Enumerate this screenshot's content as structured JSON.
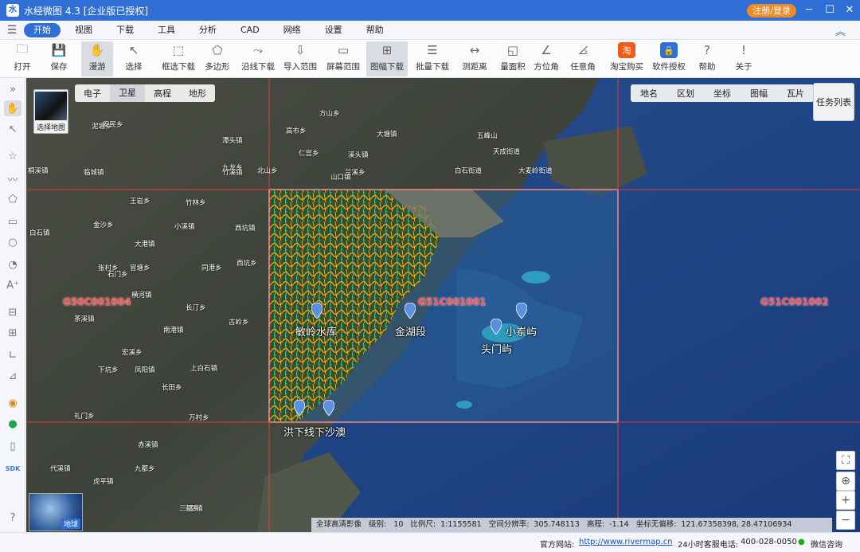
{
  "titlebar": {
    "title": "水经微图 4.3 [企业版已授权]",
    "register_label": "注册/登录"
  },
  "menu": [
    "开始",
    "视图",
    "下载",
    "工具",
    "分析",
    "CAD",
    "网络",
    "设置",
    "帮助"
  ],
  "toolbar": [
    {
      "label": "打开",
      "icon": "folder-icon"
    },
    {
      "label": "保存",
      "icon": "save-icon"
    },
    {
      "label": "漫游",
      "icon": "hand-icon"
    },
    {
      "label": "选择",
      "icon": "cursor-icon"
    },
    {
      "label": "框选下载",
      "icon": "box-download-icon"
    },
    {
      "label": "多边形",
      "icon": "polygon-icon"
    },
    {
      "label": "沿线下载",
      "icon": "line-download-icon"
    },
    {
      "label": "导入范围",
      "icon": "import-icon"
    },
    {
      "label": "屏幕范围",
      "icon": "screen-icon"
    },
    {
      "label": "图幅下载",
      "icon": "sheet-icon"
    },
    {
      "label": "批量下载",
      "icon": "batch-icon"
    },
    {
      "label": "测距离",
      "icon": "ruler-icon"
    },
    {
      "label": "量面积",
      "icon": "area-icon"
    },
    {
      "label": "方位角",
      "icon": "azimuth-icon"
    },
    {
      "label": "任意角",
      "icon": "angle-icon"
    },
    {
      "label": "淘宝购买",
      "icon": "taobao-icon"
    },
    {
      "label": "软件授权",
      "icon": "lock-icon"
    },
    {
      "label": "帮助",
      "icon": "help-icon"
    },
    {
      "label": "关于",
      "icon": "info-icon"
    }
  ],
  "map": {
    "map_types": [
      "电子",
      "卫星",
      "高程",
      "地形"
    ],
    "layers": [
      "地名",
      "区划",
      "坐标",
      "图幅",
      "瓦片"
    ],
    "task_list": "任务列表",
    "thumb_label": "选择地图",
    "globe_label": "地球",
    "sheets": [
      "G50C001004",
      "G51C001001",
      "G51C001002"
    ],
    "pins": [
      "敏岭水库",
      "金湖段",
      "小岽屿",
      "头门屿",
      "洪下线下沙澳"
    ],
    "places": [
      "泥塘乡",
      "安民乡",
      "桐溪镇",
      "临城镇",
      "白石镇",
      "竹溪镇",
      "金沙乡",
      "王岩乡",
      "大港镇",
      "茶溪镇",
      "横河镇",
      "石门乡",
      "下坑乡",
      "长田乡",
      "西坑镇",
      "礼门乡",
      "九都乡",
      "三都镇",
      "代溪镇",
      "虎平镇",
      "张村乡",
      "官塘乡",
      "同港乡",
      "西坑乡",
      "高市乡",
      "山口镇",
      "仁宫乡",
      "溪头镇",
      "方山乡",
      "大塘镇",
      "上白石镇",
      "凤阳镇",
      "赤溪镇",
      "三都乡",
      "南港镇",
      "古岭乡",
      "长汀乡",
      "宏溪乡",
      "北山乡",
      "万村乡",
      "小溪镇",
      "兰溪乡",
      "白石街道",
      "五峰山",
      "天成街道",
      "大麦岭街道",
      "潭头镇",
      "九龙乡",
      "竹林乡"
    ],
    "status": {
      "layer": "全球高清影像",
      "level_label": "级别:",
      "level": "10",
      "scale_label": "比例尺:",
      "scale": "1:1155581",
      "resolution_label": "空间分辨率:",
      "resolution": "305.748113",
      "elevation_label": "高程:",
      "elevation": "-1.14",
      "coord_label": "坐标无偏移:",
      "coord": "121.67358398, 28.47106934"
    }
  },
  "footer": {
    "site_label": "官方网站:",
    "site": "http://www.rivermap.cn",
    "phone_label": "24小时客服电话:",
    "phone": "400-028-0050",
    "wechat": "微信咨询"
  }
}
